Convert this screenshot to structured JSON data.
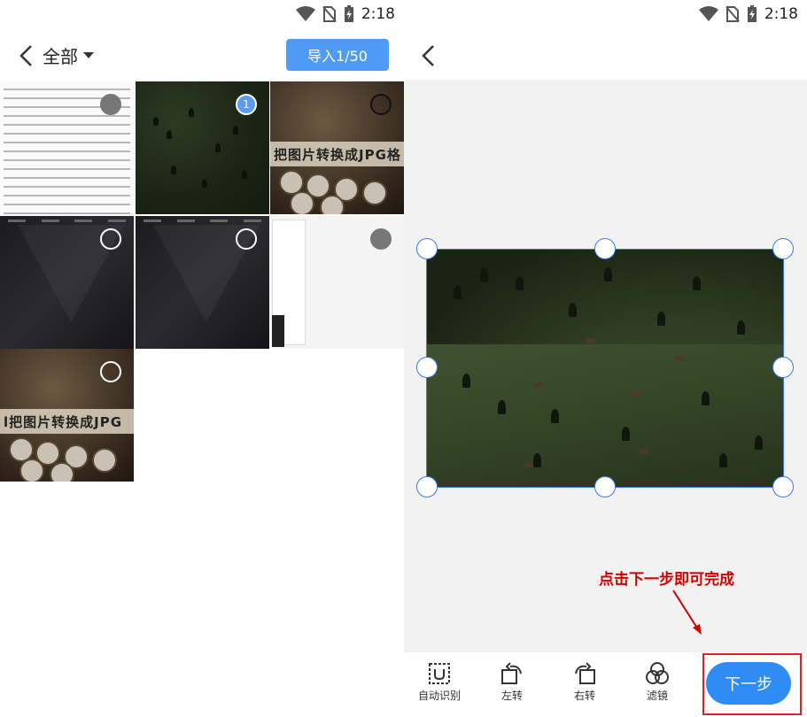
{
  "status_bar": {
    "time": "2:18"
  },
  "left": {
    "album_label": "全部",
    "import_button": "导入1/50",
    "tiles": [
      {
        "kind": "text-doc",
        "selected": false
      },
      {
        "kind": "forest",
        "selected": true,
        "badge": "1"
      },
      {
        "kind": "typewriter",
        "selected": false,
        "caption": "把图片转换成JPG格"
      },
      {
        "kind": "dark-geo",
        "selected": false
      },
      {
        "kind": "dark-geo",
        "selected": false
      },
      {
        "kind": "screenshot",
        "selected": false
      },
      {
        "kind": "typewriter",
        "selected": false,
        "caption": "l把图片转换成JPG"
      }
    ]
  },
  "right": {
    "annotation": "点击下一步即可完成",
    "tools": [
      {
        "label": "自动识别",
        "icon": "auto-detect-icon"
      },
      {
        "label": "左转",
        "icon": "rotate-left-icon"
      },
      {
        "label": "右转",
        "icon": "rotate-right-icon"
      },
      {
        "label": "滤镜",
        "icon": "filter-icon"
      }
    ],
    "next_button": "下一步"
  },
  "colors": {
    "accent": "#2f8cf5",
    "import_button": "#4e9af5",
    "annotation": "#d10000"
  }
}
